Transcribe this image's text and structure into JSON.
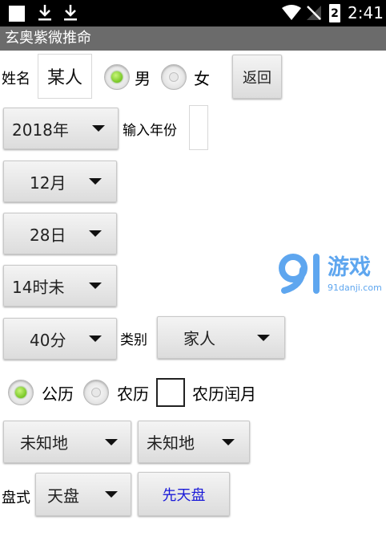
{
  "status": {
    "time": "2:41",
    "battery": "2"
  },
  "app": {
    "title": "玄奥紫微推命"
  },
  "name_row": {
    "label": "姓名",
    "value": "某人",
    "male": "男",
    "female": "女",
    "back": "返回"
  },
  "year_row": {
    "year": "2018年",
    "input_label": "输入年份",
    "input_value": ""
  },
  "month": "12月",
  "day": "28日",
  "hour": "14时未",
  "minute_row": {
    "minute": "40分",
    "category_label": "类别",
    "category": "家人"
  },
  "calendar": {
    "solar": "公历",
    "lunar": "农历",
    "leap": "农历闰月"
  },
  "location": {
    "first": "未知地",
    "second": "未知地"
  },
  "chart": {
    "label": "盘式",
    "mode": "天盘",
    "button": "先天盘"
  },
  "watermark": {
    "brand": "游戏",
    "url": "91danji.com"
  }
}
